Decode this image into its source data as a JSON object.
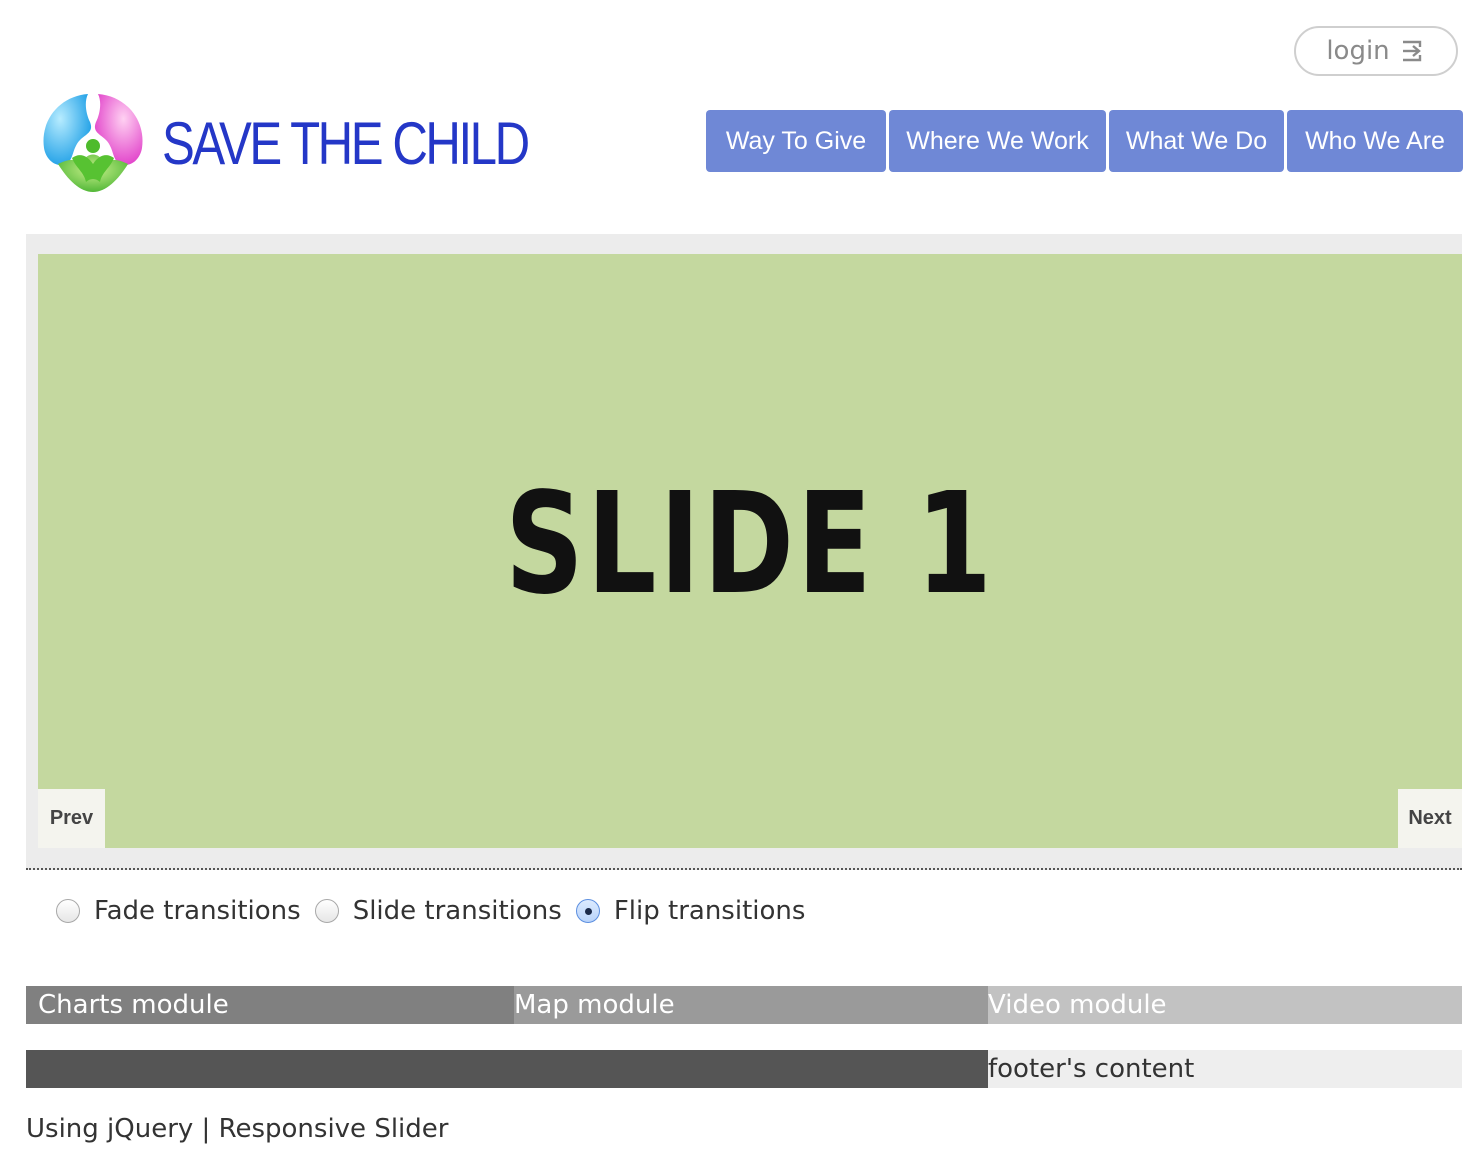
{
  "header": {
    "login_label": "login",
    "login_icon": "sign-in-icon",
    "logo_text": "SAVE THE CHILD",
    "brand_color": "#2437c7"
  },
  "nav": {
    "items": [
      {
        "label": "Way To Give"
      },
      {
        "label": "Where We Work"
      },
      {
        "label": "What We Do"
      },
      {
        "label": "Who We Are"
      }
    ],
    "button_color": "#6f88d6"
  },
  "slider": {
    "current_slide": "SLIDE 1",
    "slide_color": "#c4d89f",
    "prev_label": "Prev",
    "next_label": "Next"
  },
  "transitions": {
    "options": [
      {
        "label": "Fade transitions",
        "checked": false
      },
      {
        "label": "Slide transitions",
        "checked": false
      },
      {
        "label": "Flip transitions",
        "checked": true
      }
    ]
  },
  "modules": {
    "charts": "Charts module",
    "map": "Map module",
    "video": "Video module"
  },
  "footer": {
    "content": "footer's content",
    "credits": "Using jQuery | Responsive Slider"
  }
}
